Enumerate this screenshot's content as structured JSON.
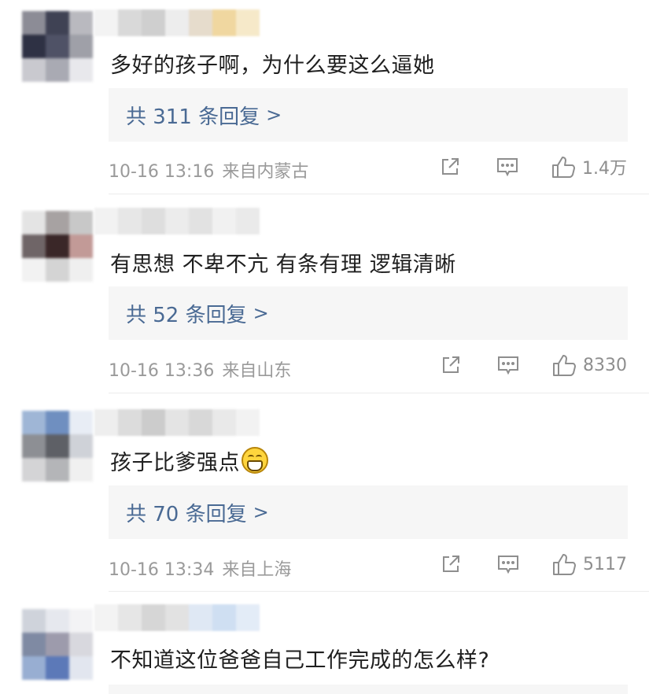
{
  "comments": [
    {
      "text": "多好的孩子啊，为什么要这么逼她",
      "reply_label": "共 311 条回复",
      "reply_chevron": ">",
      "date": "10-16 13:16",
      "location": "来自内蒙古",
      "likes": "1.4万",
      "avatar_colors": [
        "#8c8c96",
        "#3f4254",
        "#b9b9bf",
        "#2e3144",
        "#4f5266",
        "#9fa0a8",
        "#c9c9cf",
        "#a9aab3",
        "#e8e8ec"
      ],
      "name_colors": [
        "#f3f3f3",
        "#d9d9d9",
        "#cfcfcf",
        "#ededed",
        "#e6dccc",
        "#f0d7a0",
        "#f6e9c9"
      ]
    },
    {
      "text": "有思想 不卑不亢 有条有理 逻辑清晰",
      "reply_label": "共 52 条回复",
      "reply_chevron": ">",
      "date": "10-16 13:36",
      "location": "来自山东",
      "likes": "8330",
      "avatar_colors": [
        "#e4e4e4",
        "#a7a2a2",
        "#c8c8c8",
        "#6f6567",
        "#3a2728",
        "#c29a97",
        "#f2f2f2",
        "#d4d4d4",
        "#efefef"
      ],
      "name_colors": [
        "#f2f2f2",
        "#e7e7e7",
        "#dedede",
        "#ececec",
        "#e2e2e2",
        "#f1f1f1",
        "#eaeaea"
      ]
    },
    {
      "text": "孩子比爹强点",
      "has_emoji": true,
      "emoji_name": "grin-emoji",
      "reply_label": "共 70 条回复",
      "reply_chevron": ">",
      "date": "10-16 13:34",
      "location": "来自上海",
      "likes": "5117",
      "avatar_colors": [
        "#9fb6d6",
        "#6f8fc0",
        "#e8edf5",
        "#8d8f94",
        "#5e6066",
        "#cfd2d8",
        "#d4d4d6",
        "#b4b5b8",
        "#f0f0f0"
      ],
      "name_colors": [
        "#eeeeee",
        "#dcdcdc",
        "#cccccc",
        "#e4e4e4",
        "#d8d8d8",
        "#e9e9e9",
        "#f2f2f2"
      ]
    },
    {
      "text": "不知道这位爸爸自己工作完成的怎么样?",
      "avatar_colors": [
        "#cfd3db",
        "#e6e8ee",
        "#f3f3f5",
        "#7f8aa3",
        "#9d9bac",
        "#d8d8de",
        "#98aed2",
        "#5c79b8",
        "#e2e6ef"
      ],
      "name_colors": [
        "#f3f3f3",
        "#e6e6e6",
        "#d6d6d6",
        "#e2e2e2",
        "#dfe8f4",
        "#cfdff2",
        "#e3ecf7"
      ]
    }
  ],
  "icons": {
    "share": "share-icon",
    "comment": "comment-icon",
    "like": "thumbs-up-icon"
  }
}
